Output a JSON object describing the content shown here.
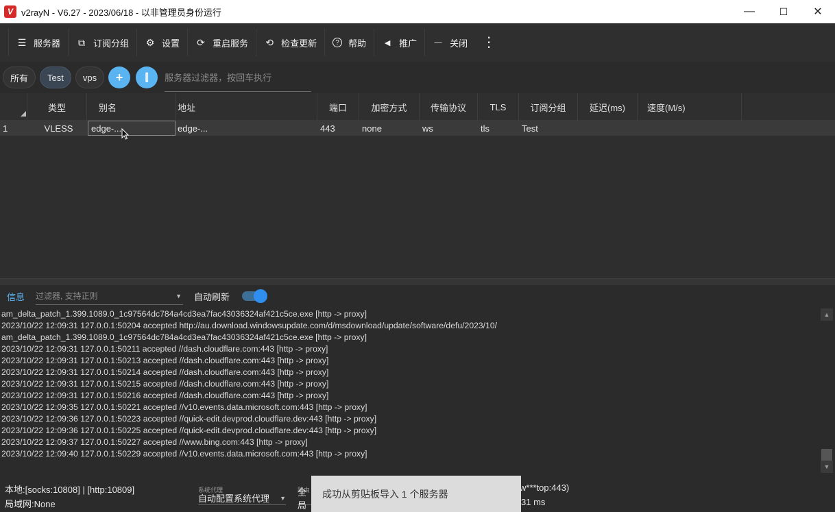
{
  "window": {
    "logo_text": "V",
    "title": "v2rayN - V6.27 - 2023/06/18 - 以非管理员身份运行",
    "min_symbol": "—",
    "max_symbol": "☐",
    "close_symbol": "✕"
  },
  "toolbar": {
    "items": [
      {
        "label": "服务器",
        "icon": "☰"
      },
      {
        "label": "订阅分组",
        "icon": "⧉"
      },
      {
        "label": "设置",
        "icon": "⚙"
      },
      {
        "label": "重启服务",
        "icon": "⟳"
      },
      {
        "label": "检查更新",
        "icon": "⟲"
      },
      {
        "label": "帮助",
        "icon": "?"
      },
      {
        "label": "推广",
        "icon": "◀"
      },
      {
        "label": "关闭",
        "icon": "—"
      }
    ],
    "more": "⋮"
  },
  "groups": {
    "chips": [
      "所有",
      "Test",
      "vps"
    ],
    "add_symbol": "+",
    "split_symbol": "⫿",
    "filter_placeholder": "服务器过滤器，按回车执行"
  },
  "grid": {
    "columns": [
      "",
      "类型",
      "别名",
      "地址",
      "端口",
      "加密方式",
      "传输协议",
      "TLS",
      "订阅分组",
      "延迟(ms)",
      "速度(M/s)"
    ],
    "rows": [
      [
        "1",
        "VLESS",
        "edge-...",
        "edge-...",
        "443",
        "none",
        "ws",
        "tls",
        "Test",
        "",
        ""
      ]
    ]
  },
  "log": {
    "tab": "信息",
    "filter_placeholder": "过滤器, 支持正则",
    "dropdown_arrow": "▼",
    "auto_refresh_label": "自动刷新",
    "auto_refresh_on": true,
    "lines": [
      "am_delta_patch_1.399.1089.0_1c97564dc784a4cd3ea7fac43036324af421c5ce.exe [http -> proxy]",
      "2023/10/22 12:09:31 127.0.0.1:50204 accepted http://au.download.windowsupdate.com/d/msdownload/update/software/defu/2023/10/",
      "am_delta_patch_1.399.1089.0_1c97564dc784a4cd3ea7fac43036324af421c5ce.exe [http -> proxy]",
      "2023/10/22 12:09:31 127.0.0.1:50211 accepted //dash.cloudflare.com:443 [http -> proxy]",
      "2023/10/22 12:09:31 127.0.0.1:50213 accepted //dash.cloudflare.com:443 [http -> proxy]",
      "2023/10/22 12:09:31 127.0.0.1:50214 accepted //dash.cloudflare.com:443 [http -> proxy]",
      "2023/10/22 12:09:31 127.0.0.1:50215 accepted //dash.cloudflare.com:443 [http -> proxy]",
      "2023/10/22 12:09:31 127.0.0.1:50216 accepted //dash.cloudflare.com:443 [http -> proxy]",
      "2023/10/22 12:09:35 127.0.0.1:50221 accepted //v10.events.data.microsoft.com:443 [http -> proxy]",
      "2023/10/22 12:09:36 127.0.0.1:50223 accepted //quick-edit.devprod.cloudflare.dev:443 [http -> proxy]",
      "2023/10/22 12:09:36 127.0.0.1:50225 accepted //quick-edit.devprod.cloudflare.dev:443 [http -> proxy]",
      "2023/10/22 12:09:37 127.0.0.1:50227 accepted //www.bing.com:443 [http -> proxy]",
      "2023/10/22 12:09:40 127.0.0.1:50229 accepted //v10.events.data.microsoft.com:443 [http -> proxy]"
    ]
  },
  "status": {
    "local": "本地:[socks:10808] | [http:10809]",
    "lan": "局域网:None",
    "sysproxy_label": "系统代理",
    "sysproxy_value": "自动配置系统代理",
    "routing_label": "路由",
    "routing_value": "全局",
    "right_top": "w***top:443)",
    "right_bottom": "31 ms"
  },
  "toast": {
    "message": "成功从剪贴板导入 1 个服务器"
  },
  "colors": {
    "accent": "#5ab4f2",
    "toggle": "#2f8ef0",
    "background": "#2b2b2b"
  }
}
